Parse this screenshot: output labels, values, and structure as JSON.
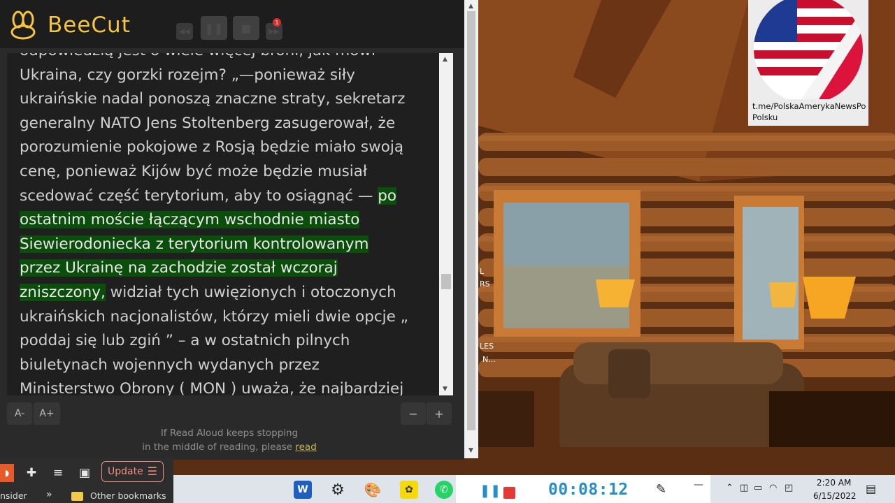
{
  "beecut": {
    "app_name": "BeeCut",
    "rewind_icon": "rewind-icon",
    "pause_icon": "pause-icon",
    "stop_icon": "stop-icon",
    "forward_icon": "fast-forward-icon"
  },
  "reader": {
    "text_lines": [
      "odpowiedzią jest o wiele więcej broni, jak mówi",
      "Ukraina, czy gorzki rozejm? „—ponieważ siły",
      "ukraińskie nadal ponoszą znaczne straty, sekretarz",
      "generalny NATO Jens Stoltenberg zasugerował, że",
      "porozumienie pokojowe z Rosją będzie miało swoją",
      "cenę, ponieważ Kijów być może będzie musiał",
      "scedować część terytorium, aby to osiągnąć — "
    ],
    "highlight_lines": [
      "po",
      "ostatnim moście łączącym wschodnie miasto",
      "Siewierodoniecka z terytorium kontrolowanym",
      "przez Ukrainę na zachodzie został wczoraj",
      "zniszczony,"
    ],
    "after_highlight": " widział tych uwięzionych i otoczonych",
    "rest_lines": [
      "ukraińskich nacjonalistów, którzy mieli dwie opcje „",
      "poddaj się lub zgiń ” – a w ostatnich pilnych",
      "biuletynach wojennych wydanych przez",
      "Ministerstwo Obrony ( MON ) uważa, że najbardziej"
    ],
    "font_decrease": "A-",
    "font_increase": "A+",
    "speed_decrease": "−",
    "speed_increase": "+",
    "notice_line1": "If Read Aloud keeps stopping",
    "notice_line2": "in the middle of reading, please ",
    "notice_link": "read"
  },
  "background_fragments": {
    "frag1": "L",
    "frag2": "RS",
    "frag3": "LES",
    "frag4": "N..."
  },
  "telegram_card": {
    "link_text": "t.me/PolskaAmerykaNewsPo Polsku"
  },
  "browser_strip": {
    "update_label": "Update",
    "update_menu_icon": "menu-icon",
    "insider_label": "nsider",
    "other_bookmarks": "Other bookmarks"
  },
  "taskbar": {
    "word_label": "W"
  },
  "recorder": {
    "timer": "00:08:12"
  },
  "clock": {
    "time": "2:20 AM",
    "date": "6/15/2022"
  },
  "colors": {
    "accent_highlight": "#0b4d0b",
    "beecut_brand": "#f5c542",
    "recorder_blue": "#2a8ec6",
    "stop_red": "#e53935"
  }
}
